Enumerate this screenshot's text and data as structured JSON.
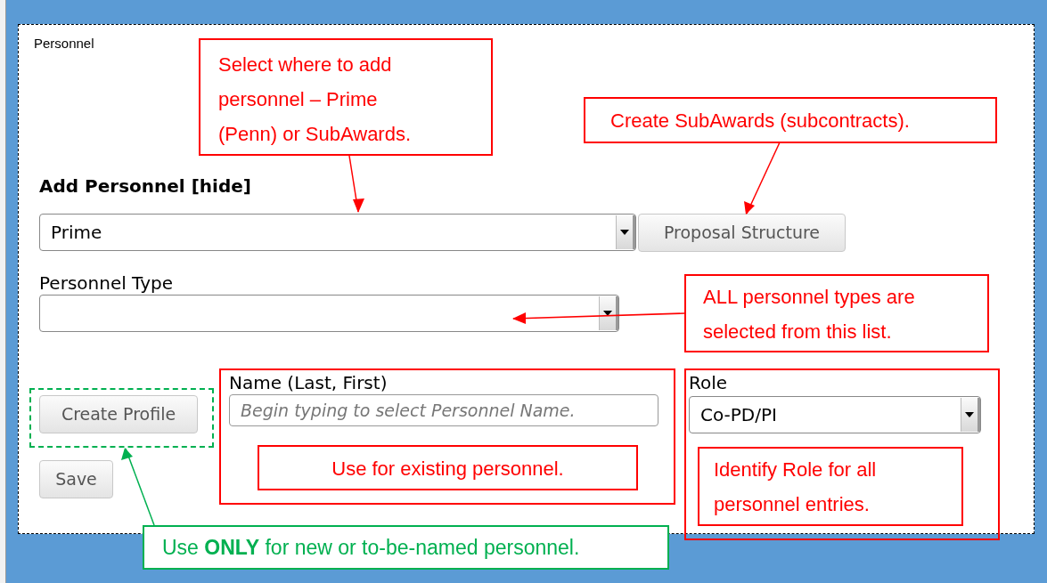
{
  "panel": {
    "title": "Personnel"
  },
  "heading": "Add Personnel [hide]",
  "location_select": {
    "value": "Prime"
  },
  "proposal_structure_button": "Proposal Structure",
  "personnel_type": {
    "label": "Personnel Type"
  },
  "create_profile_button": "Create Profile",
  "save_button": "Save",
  "name_field": {
    "label": "Name (Last, First)",
    "placeholder": "Begin typing to select Personnel Name."
  },
  "role_field": {
    "label": "Role",
    "value": "Co-PD/PI"
  },
  "callouts": [
    {
      "text": "Select where to add personnel – Prime (Penn) or SubAwards.",
      "color": "#ff0000"
    },
    {
      "text": "Create SubAwards (subcontracts).",
      "color": "#ff0000"
    },
    {
      "text": "ALL personnel types are selected from this list.",
      "color": "#ff0000"
    },
    {
      "text": "Use for existing personnel.",
      "color": "#ff0000"
    },
    {
      "text": "Identify Role for all personnel entries.",
      "color": "#ff0000"
    },
    {
      "text": "Use **ONLY** for new or to-be-named personnel.",
      "color": "#00b050"
    }
  ]
}
